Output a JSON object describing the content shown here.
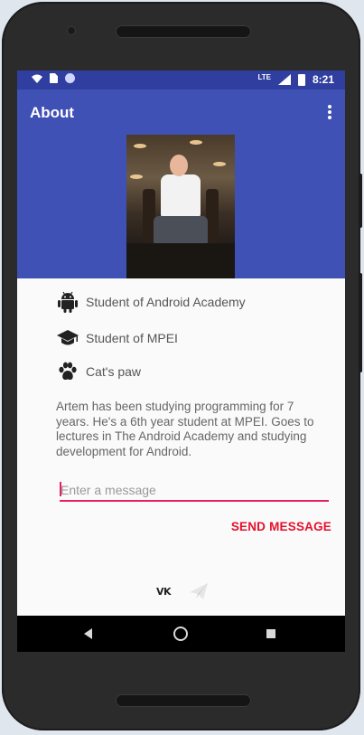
{
  "status_bar": {
    "network": "LTE",
    "time": "8:21"
  },
  "app_bar": {
    "title": "About"
  },
  "profile": {
    "items": [
      {
        "icon": "android-icon",
        "label": "Student of Android Academy"
      },
      {
        "icon": "graduation-cap-icon",
        "label": "Student of MPEI"
      },
      {
        "icon": "paw-icon",
        "label": "Cat's paw"
      }
    ],
    "bio": "Artem has been studying programming for 7 years. He's a 6th year student at MPEI. Goes to lectures in The Android Academy and studying development for Android."
  },
  "message": {
    "placeholder": "Enter a message",
    "value": "",
    "send_label": "SEND MESSAGE"
  },
  "social": {
    "vk_label": "VK"
  },
  "colors": {
    "primary": "#3f51b5",
    "primary_dark": "#303f9f",
    "accent": "#e91e63",
    "send": "#e5102c"
  }
}
